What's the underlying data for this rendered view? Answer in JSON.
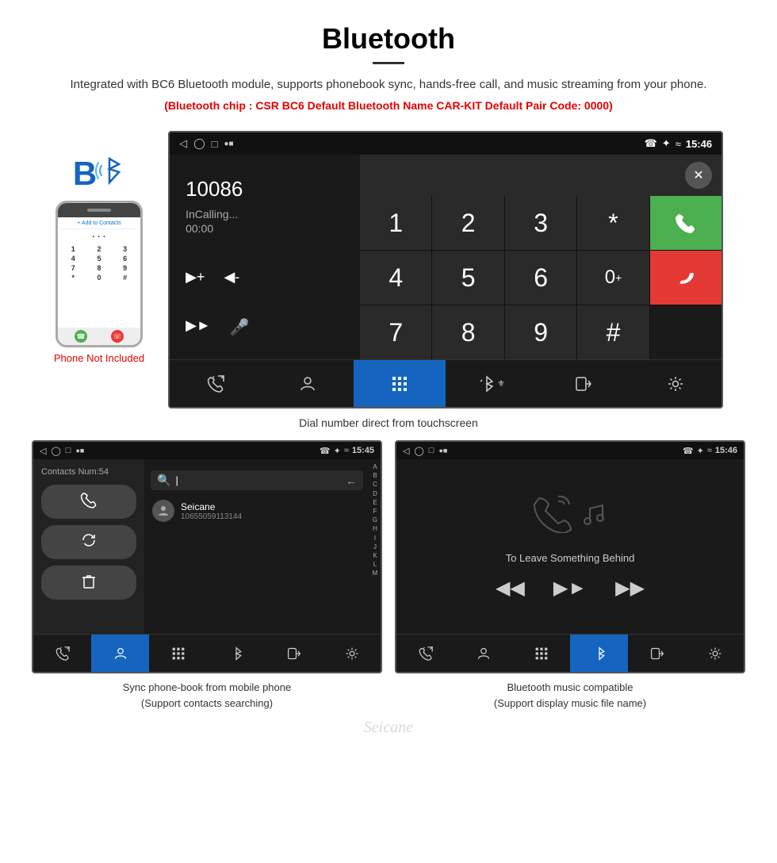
{
  "page": {
    "title": "Bluetooth",
    "divider": true,
    "description": "Integrated with BC6 Bluetooth module, supports phonebook sync, hands-free call, and music streaming from your phone.",
    "specs": "(Bluetooth chip : CSR BC6    Default Bluetooth Name CAR-KIT    Default Pair Code: 0000)",
    "dial_caption": "Dial number direct from touchscreen",
    "phone_not_included": "Phone Not Included",
    "watermark": "Seicane",
    "bottom_caption_left_line1": "Sync phone-book from mobile phone",
    "bottom_caption_left_line2": "(Support contacts searching)",
    "bottom_caption_right_line1": "Bluetooth music compatible",
    "bottom_caption_right_line2": "(Support display music file name)"
  },
  "status_bar": {
    "time_main": "15:46",
    "time_pb": "15:45",
    "time_music": "15:46"
  },
  "dial_screen": {
    "number": "10086",
    "status": "InCalling...",
    "timer": "00:00",
    "keys": [
      "1",
      "2",
      "3",
      "*",
      "4",
      "5",
      "6",
      "0+",
      "7",
      "8",
      "9",
      "#"
    ]
  },
  "phonebook": {
    "contacts_count": "Contacts Num:54",
    "contact_name": "Seicane",
    "contact_number": "10655059113144",
    "alpha_letters": [
      "A",
      "B",
      "C",
      "D",
      "E",
      "F",
      "G",
      "H",
      "I",
      "J",
      "K",
      "L",
      "M"
    ]
  },
  "music": {
    "track_title": "To Leave Something Behind"
  },
  "icons": {
    "bluetooth": "ℬ",
    "backspace": "⌫",
    "call_green": "📞",
    "call_end": "📵",
    "volume_up": "🔊",
    "volume_down": "🔉",
    "speaker": "🔈",
    "mic": "🎤",
    "transfer": "📲",
    "keypad": "⌨",
    "contacts": "👤",
    "settings": "⚙",
    "bluetooth_sym": "🔵",
    "prev": "⏮",
    "play_pause": "⏭",
    "next": "⏭",
    "phone_call": "📞",
    "search": "🔍",
    "back_arrow": "←",
    "delete_icon": "🗑",
    "refresh_icon": "↻"
  }
}
